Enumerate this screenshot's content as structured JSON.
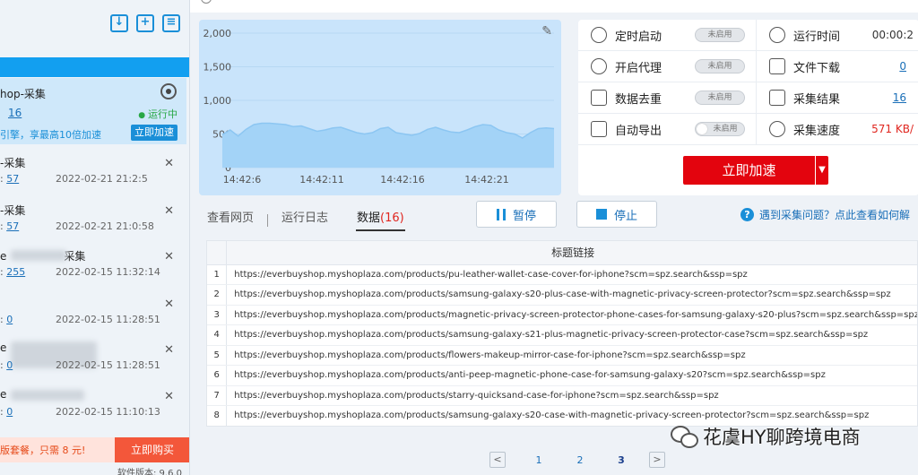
{
  "sidebar": {
    "active_task": {
      "title": "hop-采集",
      "count": "16",
      "status": "运行中",
      "tip": "引擎，享最高10倍加速",
      "accelerate_label": "立即加速"
    },
    "tasks": [
      {
        "name": "-采集",
        "prefix": ": ",
        "count": "57",
        "date": "2022-02-21 21:2:5"
      },
      {
        "name": "-采集",
        "prefix": ": ",
        "count": "57",
        "date": "2022-02-21 21:0:58"
      },
      {
        "name": "e",
        "suffix": "采集",
        "prefix": ": ",
        "count": "255",
        "date": "2022-02-15 11:32:14"
      },
      {
        "name": "",
        "prefix": ": ",
        "count": "0",
        "date": "2022-02-15 11:28:51"
      },
      {
        "name": "e",
        "prefix": ": ",
        "count": "0",
        "date": "2022-02-15 11:28:51"
      },
      {
        "name": "e",
        "prefix": ": ",
        "count": "0",
        "date": "2022-02-15 11:10:13"
      }
    ],
    "promo_text": "版套餐，只需 8 元!",
    "promo_button": "立即购买",
    "version": "软件版本: 9.6.0"
  },
  "chart_data": {
    "type": "area",
    "title": "",
    "xlabel": "",
    "ylabel": "",
    "yticks": [
      "2,000",
      "1,500",
      "1,000",
      "500",
      "0"
    ],
    "ylim": [
      0,
      2000
    ],
    "xticks": [
      "14:42:6",
      "14:42:11",
      "14:42:16",
      "14:42:21"
    ],
    "x": [
      0,
      1,
      2,
      3,
      4,
      5,
      6,
      7,
      8,
      9,
      10,
      11,
      12,
      13,
      14,
      15,
      16,
      17,
      18,
      19,
      20,
      21,
      22,
      23,
      24,
      25,
      26,
      27,
      28,
      29,
      30,
      31,
      32,
      33,
      34,
      35,
      36,
      37,
      38,
      39,
      40,
      41,
      42
    ],
    "values": [
      490,
      560,
      470,
      570,
      640,
      660,
      660,
      650,
      640,
      610,
      620,
      580,
      540,
      560,
      590,
      600,
      560,
      520,
      500,
      520,
      580,
      600,
      520,
      500,
      480,
      510,
      570,
      600,
      560,
      530,
      520,
      560,
      610,
      640,
      630,
      560,
      520,
      500,
      440,
      520,
      580,
      590,
      580
    ],
    "grid": true,
    "fill_color": "#a3d3f7",
    "line_color": "#8cc6f2"
  },
  "stats": {
    "timed_start": {
      "label": "定时启动",
      "value": "未启用"
    },
    "run_time": {
      "label": "运行时间",
      "value": "00:00:2"
    },
    "proxy": {
      "label": "开启代理",
      "value": "未启用"
    },
    "file_download": {
      "label": "文件下载",
      "value": "0"
    },
    "dedupe": {
      "label": "数据去重",
      "value": "未启用"
    },
    "results": {
      "label": "采集结果",
      "value": "16"
    },
    "auto_export": {
      "label": "自动导出",
      "value": "未启用"
    },
    "speed": {
      "label": "采集速度",
      "value": "571 KB/"
    },
    "accelerate_button": "立即加速"
  },
  "tabs": {
    "view_page": "查看网页",
    "run_log": "运行日志",
    "data": "数据",
    "data_count": "(16)"
  },
  "controls": {
    "pause": "暂停",
    "stop": "停止",
    "help": "遇到采集问题？点此查看如何解"
  },
  "table": {
    "header": "标题链接",
    "rows": [
      {
        "n": "1",
        "url": "https://everbuyshop.myshoplaza.com/products/pu-leather-wallet-case-cover-for-iphone?scm=spz.search&ssp=spz"
      },
      {
        "n": "2",
        "url": "https://everbuyshop.myshoplaza.com/products/samsung-galaxy-s20-plus-case-with-magnetic-privacy-screen-protector?scm=spz.search&ssp=spz"
      },
      {
        "n": "3",
        "url": "https://everbuyshop.myshoplaza.com/products/magnetic-privacy-screen-protector-phone-cases-for-samsung-galaxy-s20-plus?scm=spz.search&ssp=spz"
      },
      {
        "n": "4",
        "url": "https://everbuyshop.myshoplaza.com/products/samsung-galaxy-s21-plus-magnetic-privacy-screen-protector-case?scm=spz.search&ssp=spz"
      },
      {
        "n": "5",
        "url": "https://everbuyshop.myshoplaza.com/products/flowers-makeup-mirror-case-for-iphone?scm=spz.search&ssp=spz"
      },
      {
        "n": "6",
        "url": "https://everbuyshop.myshoplaza.com/products/anti-peep-magnetic-phone-case-for-samsung-galaxy-s20?scm=spz.search&ssp=spz"
      },
      {
        "n": "7",
        "url": "https://everbuyshop.myshoplaza.com/products/starry-quicksand-case-for-iphone?scm=spz.search&ssp=spz"
      },
      {
        "n": "8",
        "url": "https://everbuyshop.myshoplaza.com/products/samsung-galaxy-s20-case-with-magnetic-privacy-screen-protector?scm=spz.search&ssp=spz"
      }
    ]
  },
  "pager": {
    "prev": "<",
    "next": ">",
    "pages": [
      "1",
      "2",
      "3"
    ],
    "current": "3"
  },
  "watermark": "花虞HY聊跨境电商"
}
